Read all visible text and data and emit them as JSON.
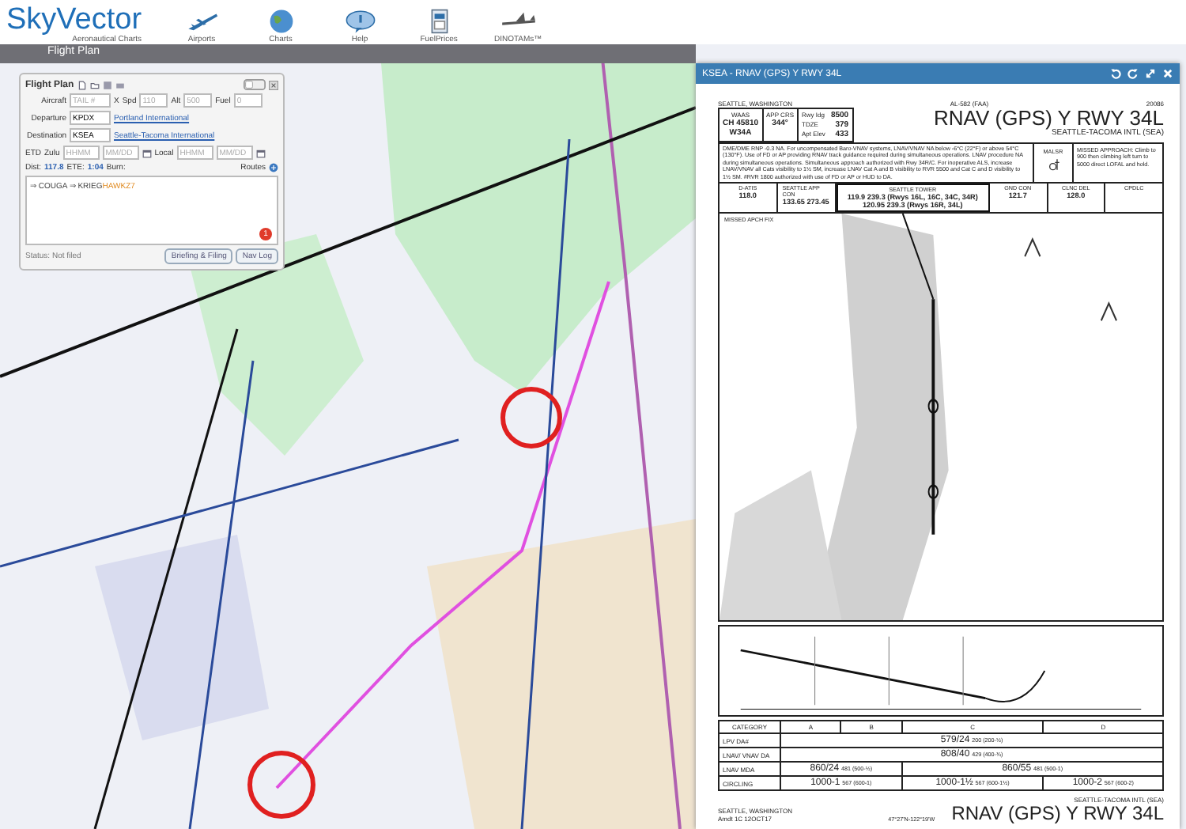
{
  "header": {
    "logo": "SkyVector",
    "logo_tagline": "Aeronautical Charts",
    "nav": [
      {
        "label": "Airports",
        "kind": "plane"
      },
      {
        "label": "Charts",
        "kind": "globe"
      },
      {
        "label": "Help",
        "kind": "help"
      },
      {
        "label": "FuelPrices",
        "kind": "fuel"
      },
      {
        "label": "DINOTAMs™",
        "kind": "jet"
      }
    ]
  },
  "flight_plan_tab": {
    "label": "Flight Plan"
  },
  "flight_plan": {
    "title": "Flight Plan",
    "aircraft": {
      "label": "Aircraft",
      "placeholder": "TAIL #",
      "clear": "X"
    },
    "speed": {
      "label": "Spd",
      "placeholder": "110"
    },
    "altitude": {
      "label": "Alt",
      "placeholder": "500"
    },
    "fuel": {
      "label": "Fuel",
      "placeholder": "0"
    },
    "departure": {
      "label": "Departure",
      "value": "KPDX",
      "link": "Portland International"
    },
    "destination": {
      "label": "Destination",
      "value": "KSEA",
      "link": "Seattle-Tacoma International"
    },
    "etd": {
      "label": "ETD",
      "zulu": "Zulu",
      "zulu_time_placeholder": "HHMM",
      "zulu_date_placeholder": "MM/DD",
      "local": "Local",
      "local_time_placeholder": "HHMM",
      "local_date_placeholder": "MM/DD"
    },
    "toggle": {
      "on": false
    },
    "dist": {
      "label": "Dist:",
      "value": "117.8"
    },
    "ete": {
      "label": "ETE:",
      "value": "1:04"
    },
    "burn": {
      "label": "Burn:"
    },
    "routes": "Routes",
    "route": [
      {
        "text": "⇒ COUGA ⇒ KRIEG",
        "kind": "waypoint"
      },
      {
        "text": "HAWKZ7",
        "kind": "procedure"
      }
    ],
    "badge": "1",
    "status": "Status: Not filed",
    "buttons": [
      "Briefing & Filing",
      "Nav Log"
    ]
  },
  "plate_window": {
    "title": "KSEA - RNAV (GPS) Y RWY 34L",
    "plate": {
      "location": "SEATTLE, WASHINGTON",
      "code": "AL-582 (FAA)",
      "cycle": "20086",
      "waas": [
        "WAAS",
        "CH 45810",
        "W34A"
      ],
      "app_crs": [
        "APP CRS",
        "344°"
      ],
      "runway_info": [
        {
          "label": "Rwy Idg",
          "value": "8500"
        },
        {
          "label": "TDZE",
          "value": "379"
        },
        {
          "label": "Apt Elev",
          "value": "433"
        }
      ],
      "title": "RNAV (GPS) Y RWY 34L",
      "airport": "SEATTLE-TACOMA INTL (SEA)",
      "notes": "DME/DME RNP -0.3 NA. For uncompensated Baro-VNAV systems, LNAV/VNAV NA below -6°C (22°F) or above 54°C (130°F). Use of FD or AP providing RNAV track guidance required during simultaneous operations. LNAV procedure NA during simultaneous operations. Simultaneous approach authorized with Rwy 34R/C. For inoperative ALS, increase LNAV/VNAV all Cats visibility to 1½ SM, increase LNAV Cat A and B visibility to RVR 5500 and Cat C and D visibility to 1½ SM. #RVR 1800 authorized with use of FD or AP or HUD to DA.",
      "lighting": "MALSR",
      "missed": "MISSED APPROACH: Climb to 900 then climbing left turn to 5000 direct LOFAL and hold.",
      "frequencies": [
        {
          "label": "D-ATIS",
          "lines": [
            "118.0"
          ]
        },
        {
          "label": "SEATTLE APP CON",
          "lines": [
            "133.65  273.45"
          ]
        },
        {
          "label": "SEATTLE TOWER",
          "lines": [
            "119.9  239.3 (Rwys 16L, 16C, 34C, 34R)",
            "120.95  239.3 (Rwys 16R, 34L)"
          ]
        },
        {
          "label": "GND CON",
          "lines": [
            "121.7"
          ]
        },
        {
          "label": "CLNC DEL",
          "lines": [
            "128.0"
          ]
        },
        {
          "label": "CPDLC"
        }
      ],
      "missed_fix": "MISSED APCH FIX",
      "minima_header": [
        "CATEGORY",
        "A",
        "B",
        "C",
        "D"
      ],
      "minima": [
        {
          "label": "LPV  DA#",
          "cells": [
            {
              "value": "579/24",
              "note": "200 (200-½)"
            }
          ]
        },
        {
          "label": "LNAV/ VNAV  DA",
          "cells": [
            {
              "value": "808/40",
              "note": "429 (400-¾)"
            }
          ]
        },
        {
          "label": "LNAV  MDA",
          "cells": [
            {
              "value": "860/24",
              "note": "481 (500-½)"
            },
            {
              "value": "860/55",
              "note": "481 (500-1)"
            }
          ]
        },
        {
          "label": "CIRCLING",
          "cells": [
            {
              "value": "1000-1",
              "note": "567 (600-1)"
            },
            {
              "value": "1000-1½",
              "note": "567 (600-1½)"
            },
            {
              "value": "1000-2",
              "note": "567 (600-2)"
            }
          ]
        }
      ],
      "footer": {
        "location": "SEATTLE, WASHINGTON",
        "amendment": "Amdt 1C  12OCT17",
        "coords": "47°27'N-122°19'W",
        "airport": "SEATTLE-TACOMA INTL (SEA)",
        "title": "RNAV (GPS) Y RWY 34L"
      }
    }
  }
}
